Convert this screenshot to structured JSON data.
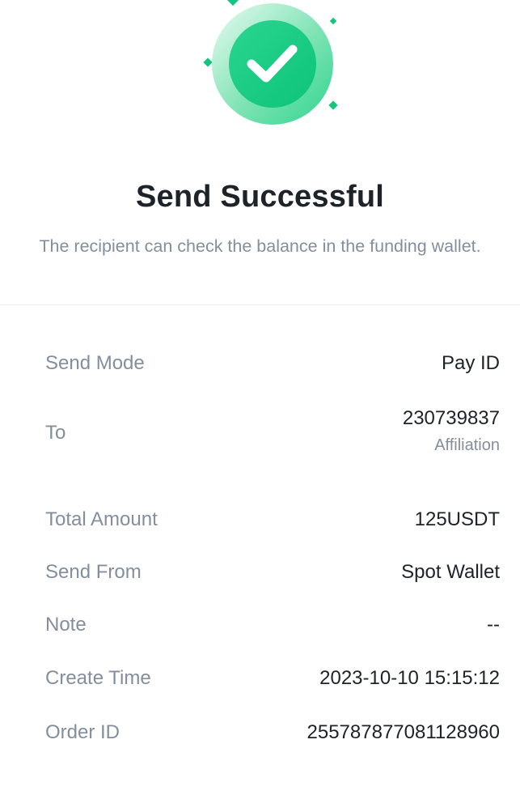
{
  "result": {
    "icon": "check-circle-icon",
    "accent_color": "#0ecb81",
    "title": "Send Successful",
    "subtitle": "The recipient can check the balance in the funding wallet."
  },
  "details": {
    "send_mode": {
      "label": "Send Mode",
      "value": "Pay ID"
    },
    "to": {
      "label": "To",
      "value": "230739837",
      "sub_value": "Affiliation"
    },
    "total_amount": {
      "label": "Total Amount",
      "value": "125USDT"
    },
    "send_from": {
      "label": "Send From",
      "value": "Spot Wallet"
    },
    "note": {
      "label": "Note",
      "value": "--"
    },
    "create_time": {
      "label": "Create Time",
      "value": "2023-10-10 15:15:12"
    },
    "order_id": {
      "label": "Order ID",
      "value": "255787877081128960"
    }
  }
}
